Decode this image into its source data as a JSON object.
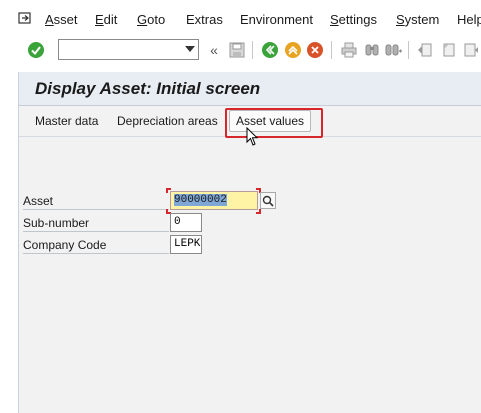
{
  "menubar": {
    "items": [
      {
        "label": "Asset",
        "underline": "A",
        "rest": "sset"
      },
      {
        "label": "Edit",
        "underline": "E",
        "rest": "dit"
      },
      {
        "label": "Goto",
        "underline": "G",
        "rest": "oto"
      },
      {
        "label": "Extras",
        "underline": "",
        "rest": "Extras"
      },
      {
        "label": "Environment",
        "underline": "",
        "rest": "Environment"
      },
      {
        "label": "Settings",
        "underline": "S",
        "rest": "ettings"
      },
      {
        "label": "System",
        "underline": "S",
        "rest": "ystem"
      },
      {
        "label": "Help",
        "underline": "",
        "rest": "Help"
      }
    ]
  },
  "toolbar": {
    "command_value": "",
    "icons": [
      "enter-icon",
      "save-icon",
      "back-icon",
      "exit-icon",
      "cancel-icon",
      "print-icon",
      "find-icon",
      "find-next-icon",
      "first-page-icon",
      "previous-page-icon",
      "next-page-icon"
    ],
    "colors": {
      "enter": "#3aa33a",
      "back": "#3aa33a",
      "exit": "#e8a321",
      "cancel": "#d9532a"
    }
  },
  "screen": {
    "title": "Display Asset: Initial screen",
    "buttons": [
      {
        "label": "Master data"
      },
      {
        "label": "Depreciation areas"
      },
      {
        "label": "Asset values"
      }
    ]
  },
  "form": {
    "asset": {
      "label": "Asset",
      "value": "90000002"
    },
    "subnumber": {
      "label": "Sub-number",
      "value": "0"
    },
    "company_code": {
      "label": "Company Code",
      "value": "LEPK"
    }
  },
  "colors": {
    "highlight": "#d7262c",
    "title_bg": "#e7edf3",
    "focus_field": "#fff3a6"
  }
}
